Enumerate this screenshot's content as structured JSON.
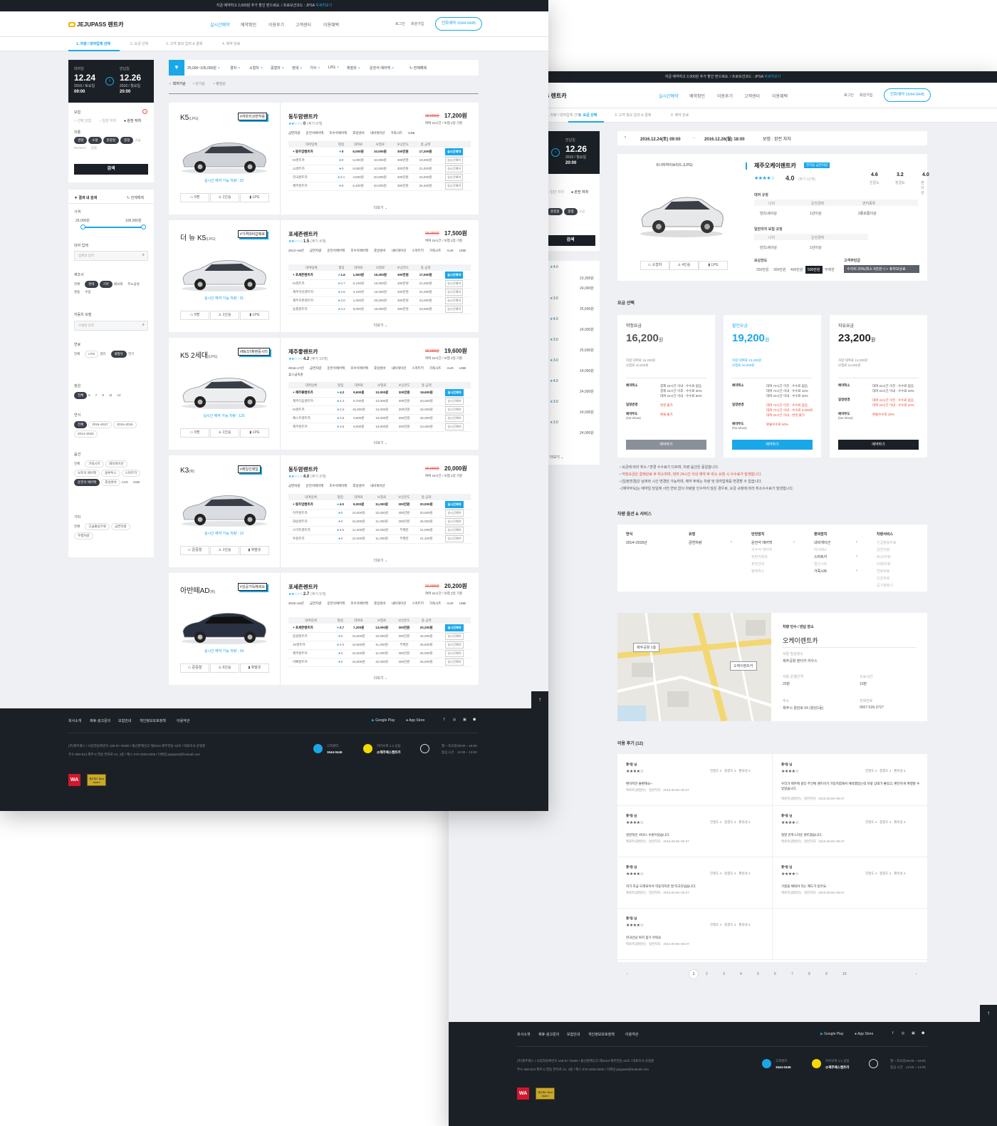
{
  "top_banner": {
    "text": "지금 예약하고 2,000원 추가 할인 받으세요. / 프로모션코드 : JPSA",
    "link": "자세히보기"
  },
  "header": {
    "logo": "JEJUPASS 렌트카",
    "logo_short": "S 렌트카",
    "nav": [
      "실시간예약",
      "예약확인",
      "이용후기",
      "고객센터",
      "이용혜택"
    ],
    "login": "로그인",
    "signup": "회원가입",
    "call": "전화예약 1544-0445"
  },
  "steps": [
    "1. 차량 / 대여업체 선택",
    "2. 요금 선택",
    "3. 고객 정보 입력 & 결제",
    "4. 예약 완료"
  ],
  "dates": {
    "pickup_label": "대여일",
    "pickup_date": "12.24",
    "pickup_sub": "2016 / 토요일",
    "pickup_time": "09:00",
    "return_label": "반납일",
    "return_date": "12.26",
    "return_sub": "2016 / 월요일",
    "return_time": "20:00"
  },
  "search_panel": {
    "insurance_label": "보험",
    "insurance_opts": [
      "선택 안함",
      "일반 자차",
      "완전 자차"
    ],
    "car_label": "차종",
    "car_types": [
      "경형",
      "소형",
      "준중형",
      "중형",
      "고급",
      "RV/SUV",
      "승합"
    ],
    "search_btn": "검색"
  },
  "filter_panel": {
    "title": "결과 내 검색",
    "reset": "전체해제",
    "price_label": "가격",
    "price_min": "25,000원",
    "price_max": "105,000원",
    "company_label": "대여 업체",
    "company_placeholder": "업체명 입력",
    "maker_label": "제조사",
    "makers": [
      "전체",
      "현대",
      "기아",
      "쉐보레",
      "르노삼성",
      "쌍용",
      "수입"
    ],
    "model_label": "자동차 모델",
    "model_placeholder": "모델명 입력",
    "fuel_label": "연료",
    "fuels": [
      "전체",
      "LPG",
      "경유",
      "휘발유",
      "전기"
    ],
    "seat_label": "정원",
    "seats": [
      "전체",
      "5",
      "7",
      "9",
      "11",
      "12"
    ],
    "year_label": "연식",
    "years": [
      "전체",
      "2016~2017",
      "2015~2016",
      "2014~2016"
    ],
    "option_label": "옵션",
    "options": [
      "전체",
      "가죽시트",
      "네비게이션",
      "보조석 에어백",
      "블루투스",
      "스마트키",
      "운전석 에어백",
      "후방센서",
      "AUX",
      "USB"
    ],
    "etc_label": "기타",
    "etcs": [
      "전체",
      "긴급출동무료",
      "금연차량",
      "주행차량"
    ]
  },
  "result_bar": {
    "chips": [
      "25,000~105,000원",
      "경차",
      "소형차",
      "중형차",
      "현대",
      "기아",
      "LPG",
      "휘발유",
      "운전석 에어백"
    ],
    "reset": "전체해제",
    "sort": [
      "최저가순",
      "인기순",
      "평점순"
    ]
  },
  "table_headers": [
    "대여업체",
    "평점",
    "대여료",
    "보험료",
    "보상한도",
    "총 금액"
  ],
  "realtime_label": "실시간예약",
  "more_label": "더보기",
  "cars": [
    {
      "name": "K5",
      "fuel": "(LPG)",
      "tag": "#처마지코면허용",
      "avail": "실시간 예약 가능 차량 : 32",
      "icons": [
        "5명",
        "1인승",
        "LPG"
      ],
      "company": "동두암렌트카",
      "rating": "0",
      "reviews": "(후기 0개)",
      "old_price": "18,000원",
      "price": "17,200원",
      "info": "여여 24시간 / 보험 2일 기준",
      "opts": [
        "금연차량",
        "운전석에어백",
        "조수석에어백",
        "후방센서",
        "내비게이션",
        "가죽시트",
        "USB"
      ],
      "rows": [
        [
          "동두암렌트카",
          "0",
          "6,000원",
          "10,000원",
          "300만원",
          "17,200원"
        ],
        [
          "KI렌트카",
          "0",
          "6,000원",
          "10,000원",
          "300만원",
          "18,000원"
        ],
        [
          "JJ렌트카",
          "0",
          "8,000원",
          "10,000원",
          "300만원",
          "21,000원"
        ],
        [
          "한국렌트카",
          "3.1",
          "3,500원",
          "20,000원",
          "300만원",
          "23,000원"
        ],
        [
          "제주렌트카",
          "0",
          "6,400원",
          "20,000원",
          "300만원",
          "26,400원"
        ]
      ]
    },
    {
      "name": "더 뉴 K5",
      "fuel": "(LPG)",
      "tag": "#가격대비갑메로",
      "avail": "실시간 예약 가능 차량 : 31",
      "icons": [
        "5명",
        "1인승",
        "LPG"
      ],
      "company": "포세존렌트카",
      "rating": "1.5",
      "reviews": "(후기 4개)",
      "old_price": "18,000원",
      "price": "17,500원",
      "info": "여여 24시간 / 보험 2일 기준",
      "opts": [
        "2014~16년",
        "금연차량",
        "운전석에어백",
        "조수석에어백",
        "후방센서",
        "내비게이션",
        "스마트키",
        "가죽시트",
        "AUX",
        "USB"
      ],
      "rows": [
        [
          "포세존렌트카",
          "1.6",
          "1,500원",
          "15,000원",
          "300만원",
          "17,500원"
        ],
        [
          "KI렌트카",
          "3.7",
          "6,100원",
          "15,000원",
          "300만원",
          "21,000원"
        ],
        [
          "제주미션렌트카",
          "4.5",
          "3,100원",
          "15,000원",
          "400만원",
          "22,000원"
        ],
        [
          "제주지존렌트카",
          "3.0",
          "1,000원",
          "20,000원",
          "300만원",
          "23,000원"
        ],
        [
          "동풍렌트카",
          "4.2",
          "8,000원",
          "15,000원",
          "300만원",
          "23,000원"
        ]
      ]
    },
    {
      "name": "K5 2세대",
      "fuel": "(LPG)",
      "tag": "#BEST플렌중시미",
      "avail": "실시간 예약 가능 차량 : 125",
      "icons": [
        "5명",
        "1인승",
        "LPG"
      ],
      "company": "제주좋렌트카",
      "rating": "4.2",
      "reviews": "(후기 10개)",
      "old_price": "20,000원",
      "price": "19,600원",
      "info": "여여 24시간 / 보험 2일 기준",
      "opts": [
        "2016~17년",
        "금연차량",
        "운전석에어백",
        "조수석에어백",
        "후방센서",
        "내비게이션",
        "스마트키",
        "가죽시트",
        "AUX",
        "USB",
        "휴스급속원"
      ],
      "rows": [
        [
          "제주좋렌트카",
          "4.2",
          "9,600원",
          "10,000원",
          "300만원",
          "19,600원"
        ],
        [
          "제주다음렌트카",
          "4.3",
          "9,700원",
          "10,000원",
          "300만원",
          "20,000원"
        ],
        [
          "KI렌트카",
          "4.0",
          "16,000원",
          "10,000원",
          "300만원",
          "26,000원"
        ],
        [
          "예스트렌트카",
          "3.8",
          "9,800원",
          "15,000원",
          "300만원",
          "25,000원"
        ],
        [
          "제주렌트카",
          "3.5",
          "9,000원",
          "15,000원",
          "300만원",
          "24,000원"
        ]
      ]
    },
    {
      "name": "K3",
      "fuel": "(휘)",
      "tag": "#제일인제일",
      "avail": "실시간 예약 가능 차량 : 12",
      "icons": [
        "준중형",
        "1인승",
        "휘발유"
      ],
      "company": "동두암렌트카",
      "rating": "4.0",
      "reviews": "(후기 3개)",
      "old_price": "22,000원",
      "price": "20,000원",
      "info": "여여 24시간 / 보험 2일 기준",
      "opts": [
        "금연차량",
        "운전석에어백",
        "조수석에어백",
        "후방센서",
        "내비게이션"
      ],
      "rows": [
        [
          "동두암렌트카",
          "4.0",
          "9,000원",
          "11,000원",
          "300만원",
          "20,000원"
        ],
        [
          "아주렌트카",
          "0",
          "10,000원",
          "10,000원",
          "300만원",
          "20,000원"
        ],
        [
          "대승렌트카",
          "0",
          "15,000원",
          "11,000원",
          "300만원",
          "26,000원"
        ],
        [
          "스마트렌트카",
          "3.6",
          "11,000원",
          "10,000원",
          "무제한",
          "21,000원"
        ],
        [
          "투렌트카",
          "0",
          "10,400원",
          "11,000원",
          "무제한",
          "21,400원"
        ]
      ]
    },
    {
      "name": "아반떼AD",
      "fuel": "(휘)",
      "tag": "#성공가득해세요",
      "avail": "실시간 예약 가능 차량 : 34",
      "icons": [
        "준중형",
        "5인승",
        "휘발유"
      ],
      "company": "포세존렌트카",
      "rating": "2.7",
      "reviews": "(후기 5개)",
      "old_price": "22,000원",
      "price": "20,200원",
      "info": "여여 24시간 / 보험 2일 기준",
      "opts": [
        "2015~16년",
        "금연차량",
        "운전석에어백",
        "조수석에어백",
        "후방센서",
        "내비게이션",
        "스마트키",
        "가죽시트",
        "AUX",
        "USB"
      ],
      "rows": [
        [
          "포세존렌트카",
          "2.7",
          "7,200원",
          "13,000원",
          "300만원",
          "20,200원"
        ],
        [
          "동원렌트카",
          "0",
          "15,000원",
          "10,000원",
          "300만원",
          "25,000원"
        ],
        [
          "JS렌트카",
          "4.0",
          "15,600원",
          "11,000원",
          "무제한",
          "26,600원"
        ],
        [
          "제주렌트카",
          "0",
          "15,000원",
          "11,000원",
          "300만원",
          "26,000원"
        ],
        [
          "아빠렌트카",
          "0",
          "16,000원",
          "10,000원",
          "300만원",
          "26,000원"
        ]
      ]
    }
  ],
  "footer": {
    "links": [
      "회사소개",
      "제휴·광고문의",
      "보험안내",
      "개인정보보호정책",
      "이용약관"
    ],
    "google_play": "Google Play",
    "app_store": "App Store",
    "company_line1": "(주)제주패스 / 사업자등록번호 105-87-76300 / 통신판매신고 제2015-제주연동-43호 / 대표이사 윤형준",
    "company_line2": "주소 690-813 제주시 연동 연북로 21, 4층 / 팩스 070-4325-0205 / 이메일 jejupass@hotmail.com",
    "cs_label": "고객센터",
    "cs_number": "1544-0445",
    "kakao_label": "카카오톡 1:1 상담",
    "kakao_id": "@제주패스렌트카",
    "hours_label1": "월 ~ 토요일",
    "hours_val1": "09:00 ~ 18:00",
    "hours_label2": "점심 시간",
    "hours_val2": "12:00 ~ 13:00",
    "badge": "WA",
    "badge2": "제주패스 Best Award"
  },
  "detail": {
    "summary": {
      "pickup": "2016.12.24(토) 09:00",
      "ret": "2016.12.26(월) 18:00",
      "ins": "보험 : 완전 자차"
    },
    "car_name": "쏘나타하이브리드 (LPG)",
    "car_icons": [
      "소형차",
      "4인승",
      "LPG"
    ],
    "company": "제주오케이렌트카",
    "company_tag": "전자동 금연차량",
    "rating": "4.0",
    "reviews": "(후기 12개)",
    "scores": [
      {
        "v": "4.6",
        "l": "친절도"
      },
      {
        "v": "3.2",
        "l": "청결도"
      },
      {
        "v": "4.0",
        "l": "편의성"
      }
    ],
    "rent_rule_title": "대여 규정",
    "rent_rule_heads": [
      "나이",
      "운전경력",
      "면허종류"
    ],
    "rent_rule_vals": [
      "만21세이상",
      "1년이상",
      "2종보통이상"
    ],
    "ins_rule_title": "일반자차 보험 규정",
    "ins_rule_heads": [
      "나이",
      "운전경력"
    ],
    "ins_rule_vals": [
      "만21세이상",
      "1년이상"
    ],
    "limit_label": "보상한도",
    "limits": [
      "250만원",
      "300만원",
      "400만원",
      "500만원",
      "무제한"
    ],
    "self_label": "고객부담금",
    "self_val": "수리비 20%(최소 5만원~) + 휴차보상료",
    "side_rows": [
      "4.0",
      "23,300원",
      "24,000원",
      "3.0",
      "25,600원",
      "4.0",
      "24,000원",
      "3.0",
      "25,600원",
      "3.0",
      "24,000원",
      "4.0",
      "24,000원",
      "3.0",
      "24,000원",
      "3.0",
      "24,000원"
    ],
    "side_more": "더보기",
    "fee_title": "요금 선택",
    "fees": [
      {
        "name": "약정요금",
        "price": "16,200",
        "unit": "원",
        "d1": "차량 대여료 16,200원",
        "d2": "보험료 10,000원",
        "btn": "예약하기",
        "r1": "예약취소",
        "v1": [
          "결제 24시간 이내 : 수수료 없음",
          "결제 24시간 이후 : 수수료 30%",
          "대여 24시간 이내 : 수수료 50%"
        ],
        "r2": "일정변경",
        "v2": [
          "변경 불가"
        ],
        "r3": "예약부도",
        "r3s": "(No-show)",
        "v3": [
          "환불 불가"
        ]
      },
      {
        "name": "할인요금",
        "price": "19,200",
        "unit": "원",
        "d1": "차량 대여료 13,200원",
        "d2": "보험료 10,000원",
        "btn": "예약하기",
        "r1": "예약취소",
        "v1": [
          "대여 72시간 이전 : 수수료 없음",
          "대여 72시간 이내 : 수수료 10%",
          "대여 24시간 이내 : 수수료 30%"
        ],
        "r2": "일정변경",
        "v2": [
          "대여 72시간 이전 : 수수료 없음",
          "대여 72시간 이내 : 수수료 5,000원",
          "대여 24시간 이내 : 변경 불가"
        ],
        "r3": "예약부도",
        "r3s": "(No-show)",
        "v3": [
          "환불수수료 50%"
        ]
      },
      {
        "name": "자유요금",
        "price": "23,200",
        "unit": "원",
        "d1": "차량 대여료 13,200원",
        "d2": "보험료 10,000원",
        "btn": "예약하기",
        "r1": "예약취소",
        "v1": [
          "대여 24시간 이전 : 수수료 없음",
          "대여 24시간 이내 : 수수료 20%"
        ],
        "r2": "일정변경",
        "v2": [
          "대여 24시간 이전 : 수수료 없음",
          "대여 24시간 이내 : 수수료 20%"
        ],
        "r3": "예약부도",
        "r3s": "(No-show)",
        "v3": [
          "환불수수료 30%"
        ]
      }
    ],
    "notes": [
      "요금에 따라 취소 / 변경 수수료가 다르며, 차량 옵션은 동일합니다.",
      "약정요금은 결제완료 후 취소하며, 대여 24시간 이내 예약 후 취소 요청 시 수수료가 발생합니다.",
      "[일정변경]은 날짜와 시간 변경만 가능하며, 예약 후에는 차량 및 대여업체를 변경할 수 없습니다.",
      "[예약부도]는 예약일 당일에 사전 연락 없이 차량을 인수하지 않은 경우로, 요금 규정에 따라 취소수수료가 발생합니다."
    ],
    "opt_title": "차량 옵션 & 서비스",
    "opt_cols": [
      {
        "h": "연식",
        "items": [
          "2014~2015년"
        ]
      },
      {
        "h": "유형",
        "items": [
          "금연차량"
        ]
      },
      {
        "h": "안전장치",
        "items": [
          "운전석 에어백",
          "조수석 에어백",
          "후방카메라",
          "후방센서",
          "블랙박스"
        ]
      },
      {
        "h": "편의장치",
        "items": [
          "내비게이션",
          "하이패스",
          "스마트키",
          "열선시트",
          "가죽시트"
        ]
      },
      {
        "h": "차량서비스",
        "items": [
          "긴급출동무료",
          "금연차량",
          "AUX차량",
          "USB차량",
          "연료무료",
          "인원무료",
          "공기청정기"
        ]
      }
    ],
    "map_label1": "제주공항 1층",
    "map_label2": "오케이렌트카",
    "loc_title": "차량 인수 / 반납 장소",
    "loc_name": "오케이렌트카",
    "loc_place_label": "셔틀 탑승장소",
    "loc_place": "제주공항 렌터카 하우스",
    "loc_interval_label": "셔틀 운행간격",
    "loc_interval": "20분",
    "loc_time_label": "소요시간",
    "loc_time": "10분",
    "loc_addr_label": "주소",
    "loc_addr": "제주시 용담로 64 (용담1동)",
    "loc_tel_label": "전화번호",
    "loc_tel": "0507-526-3727",
    "review_title": "이용 후기 (12)",
    "reviews_list": [
      {
        "name": "홍*동 님",
        "scores": "친절도 4 · 청결도 4 · 편의성 4",
        "text": "편하지만 불편해요~",
        "meta": "백로트(휘발유) · 일반자차 · 2016.09.06~09.07"
      },
      {
        "name": "홍*동 님",
        "scores": "친절도 4 · 청결도 4 · 편의성 4",
        "text": "우리가 제주에 왔다 주간에 렌트비가 가장저렴해서 예약했었는데 차량 상태가 좋았고, 편안하게 여행할 수 있었습니다.",
        "meta": "백로트(휘발유) · 일반자차 · 2016.09.06~09.07"
      },
      {
        "name": "홍*동 님",
        "scores": "친절도 4 · 청결도 4 · 편의성 4",
        "text": "일반적인 서비스 수준이었습니다.",
        "meta": "백로트(휘발유) · 일반자차 · 2016.09.06~09.07"
      },
      {
        "name": "홍*동 님",
        "scores": "친절도 4 · 청결도 4 · 편의성 4",
        "text": "정말 만족스러운 렌트였습니다.",
        "meta": "백로트(휘발유) · 일반자차 · 2016.09.06~09.07"
      },
      {
        "name": "홍*동 님",
        "scores": "친절도 4 · 청결도 4 · 편의성 4",
        "text": "차가 조금 오래되어서 작동하지만 잘 타고다녔습니다.",
        "meta": "백로트(휘발유) · 일반자차 · 2016.09.06~09.07"
      },
      {
        "name": "홍*동 님",
        "scores": "친절도 4 · 청결도 4 · 편의성 4",
        "text": "기름을 채워야 하는 제도가 있어요.",
        "meta": "백로트(휘발유) · 일반자차 · 2016.09.06~09.07"
      },
      {
        "name": "홍*동 님",
        "scores": "친절도 4 · 청결도 4 · 편의성 4",
        "text": "한국인남 위치 찾기 쉬워요",
        "meta": "백로트(휘발유) · 일반자차 · 2016.09.06~09.07"
      }
    ],
    "pages": [
      "1",
      "2",
      "3",
      "4",
      "5",
      "6",
      "7",
      "8",
      "9",
      "10"
    ]
  }
}
